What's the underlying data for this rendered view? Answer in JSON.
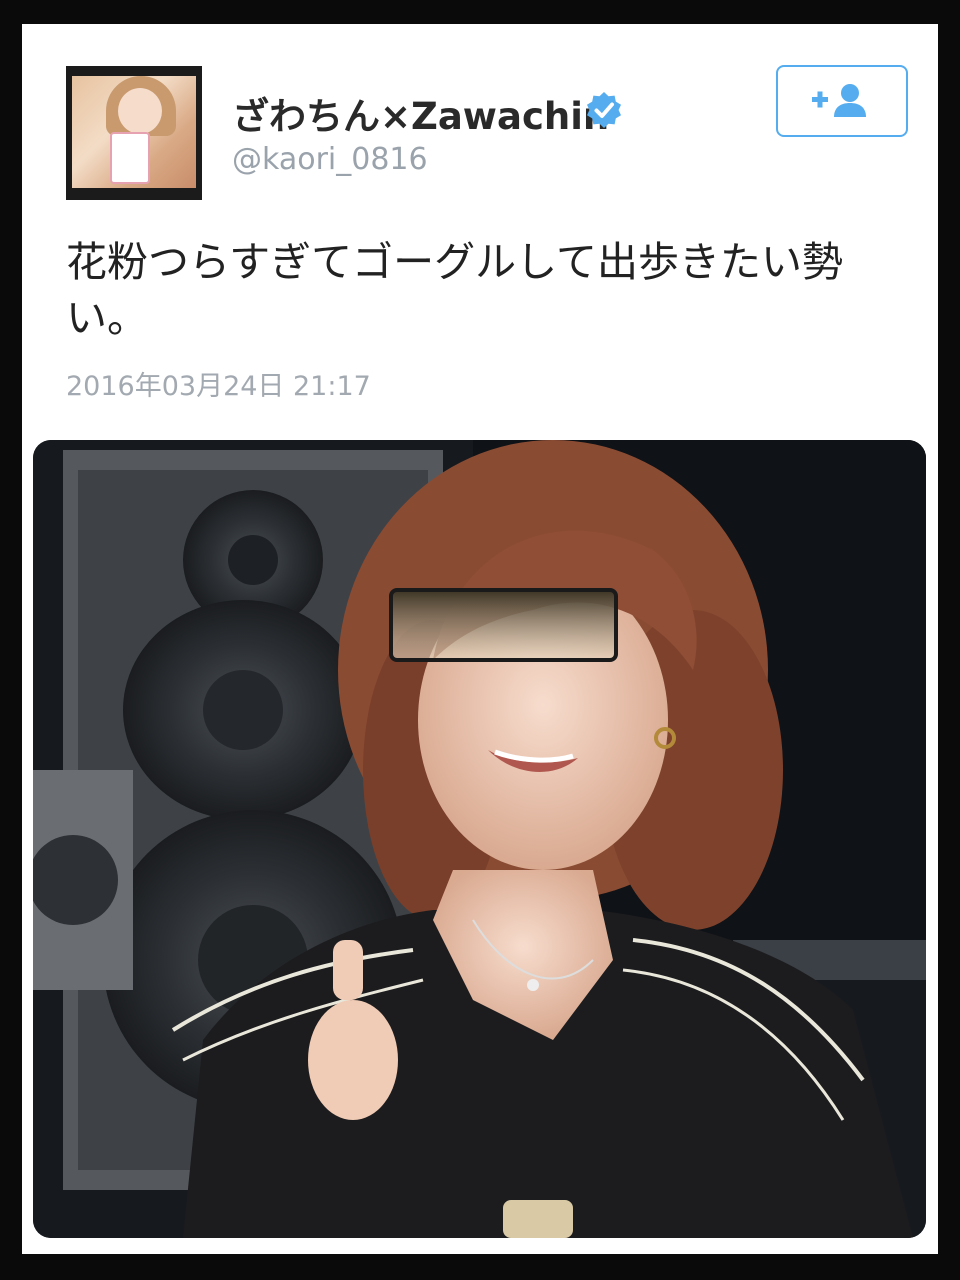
{
  "tweet": {
    "display_name": "ざわちん×Zawachin",
    "handle": "@kaori_0816",
    "text": "花粉つらすぎてゴーグルして出歩きたい勢い。",
    "timestamp": "2016年03月24日 21:17",
    "follow_icon": "add-user-icon",
    "verified_icon": "verified-badge-icon",
    "media_description": ""
  },
  "colors": {
    "accent": "#55acee",
    "verified": "#55acee",
    "text": "#222222",
    "muted": "#9aa3ab"
  }
}
